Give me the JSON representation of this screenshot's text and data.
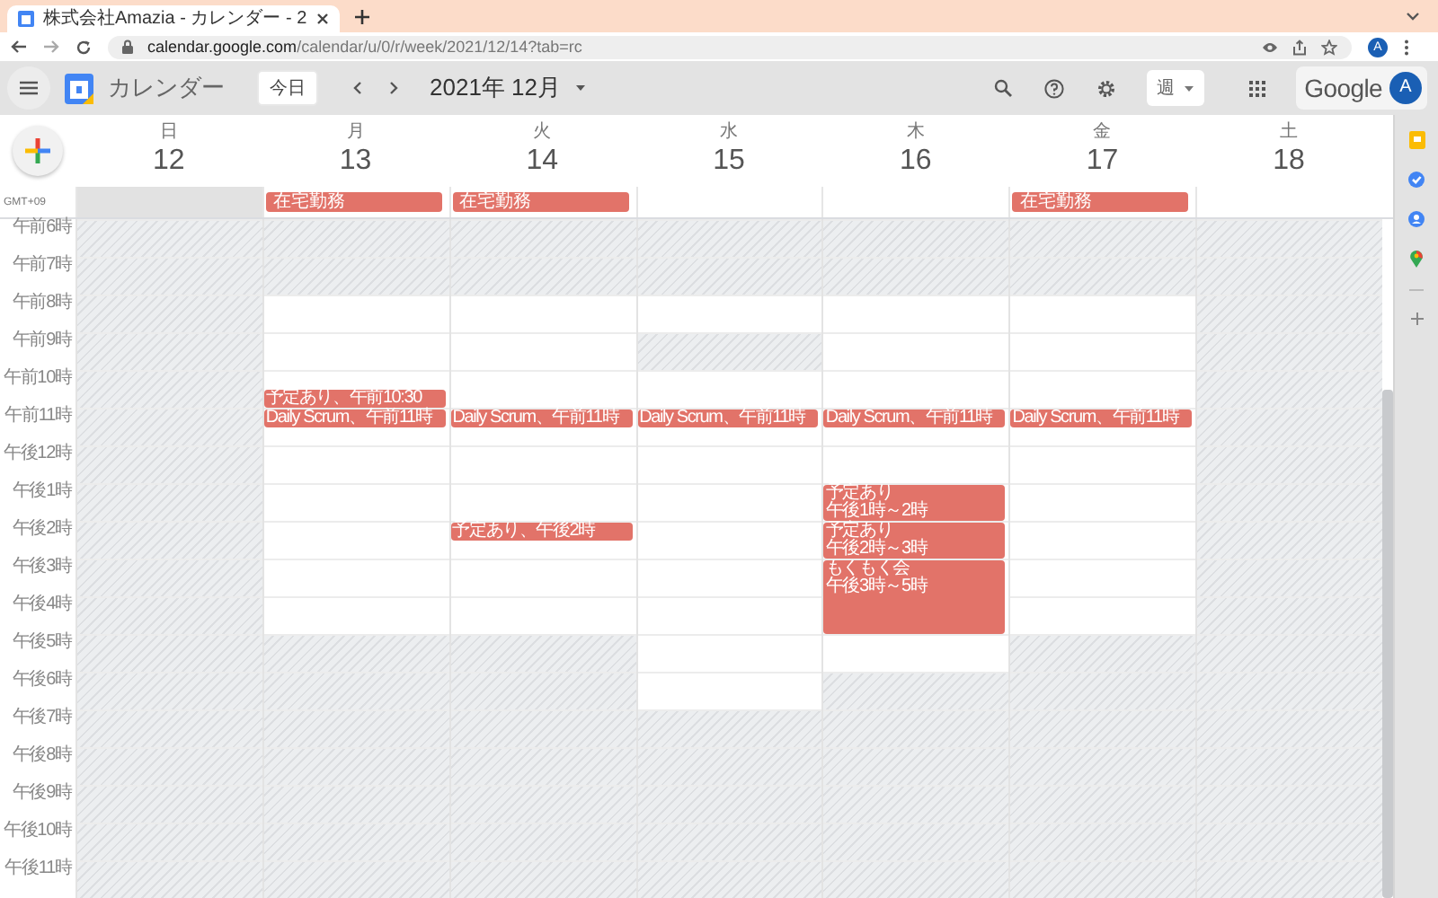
{
  "browser": {
    "tab_title": "株式会社Amazia - カレンダー - 2",
    "url": {
      "host": "calendar.google.com",
      "path": "/calendar/u/0/r/week/2021/12/14?tab=rc"
    },
    "profile_initial": "A"
  },
  "app": {
    "name": "カレンダー",
    "today_button": "今日",
    "period": "2021年 12月",
    "view": "週",
    "brand": "Google",
    "avatar_initial": "A"
  },
  "timezone": "GMT+09",
  "hours": [
    "午前6時",
    "午前7時",
    "午前8時",
    "午前9時",
    "午前10時",
    "午前11時",
    "午後12時",
    "午後1時",
    "午後2時",
    "午後3時",
    "午後4時",
    "午後5時",
    "午後6時",
    "午後7時",
    "午後8時",
    "午後9時",
    "午後10時",
    "午後11時"
  ],
  "days": [
    {
      "weekday": "日",
      "date": "12",
      "allday_shaded": true,
      "slots": [
        {
          "open": false
        },
        {
          "open": false
        },
        {
          "open": false
        },
        {
          "open": false
        },
        {
          "open": false
        },
        {
          "open": false
        },
        {
          "open": false
        },
        {
          "open": false
        },
        {
          "open": false
        },
        {
          "open": false
        },
        {
          "open": false
        },
        {
          "open": false
        },
        {
          "open": false
        },
        {
          "open": false
        },
        {
          "open": false
        },
        {
          "open": false
        },
        {
          "open": false
        },
        {
          "open": false
        }
      ]
    },
    {
      "weekday": "月",
      "date": "13",
      "allday_shaded": false,
      "allday_events": [
        "在宅勤務"
      ],
      "slots": [
        {
          "open": false
        },
        {
          "open": false
        },
        {
          "open": true
        },
        {
          "open": true
        },
        {
          "open": true,
          "events": [
            {
              "kind": "half-late",
              "title": "予定あり、午前10:30"
            }
          ]
        },
        {
          "open": true,
          "events": [
            {
              "kind": "half",
              "title": "Daily Scrum、午前11時"
            }
          ]
        },
        {
          "open": true
        },
        {
          "open": true
        },
        {
          "open": true
        },
        {
          "open": true
        },
        {
          "open": true
        },
        {
          "open": false
        },
        {
          "open": false
        },
        {
          "open": false
        },
        {
          "open": false
        },
        {
          "open": false
        },
        {
          "open": false
        },
        {
          "open": false
        }
      ]
    },
    {
      "weekday": "火",
      "date": "14",
      "allday_shaded": false,
      "allday_events": [
        "在宅勤務"
      ],
      "slots": [
        {
          "open": false
        },
        {
          "open": false
        },
        {
          "open": true
        },
        {
          "open": true
        },
        {
          "open": true
        },
        {
          "open": true,
          "events": [
            {
              "kind": "half",
              "title": "Daily Scrum、午前11時"
            }
          ]
        },
        {
          "open": true
        },
        {
          "open": true
        },
        {
          "open": true,
          "events": [
            {
              "kind": "half",
              "title": "予定あり、午後2時"
            }
          ]
        },
        {
          "open": true
        },
        {
          "open": true
        },
        {
          "open": false
        },
        {
          "open": false
        },
        {
          "open": false
        },
        {
          "open": false
        },
        {
          "open": false
        },
        {
          "open": false
        },
        {
          "open": false
        }
      ]
    },
    {
      "weekday": "水",
      "date": "15",
      "allday_shaded": false,
      "slots": [
        {
          "open": false
        },
        {
          "open": false
        },
        {
          "open": true
        },
        {
          "open": false
        },
        {
          "open": true
        },
        {
          "open": true,
          "events": [
            {
              "kind": "half",
              "title": "Daily Scrum、午前11時"
            }
          ]
        },
        {
          "open": true
        },
        {
          "open": true
        },
        {
          "open": true
        },
        {
          "open": true
        },
        {
          "open": true
        },
        {
          "open": true
        },
        {
          "open": true
        },
        {
          "open": false
        },
        {
          "open": false
        },
        {
          "open": false
        },
        {
          "open": false
        },
        {
          "open": false
        }
      ]
    },
    {
      "weekday": "木",
      "date": "16",
      "allday_shaded": false,
      "slots": [
        {
          "open": false
        },
        {
          "open": false
        },
        {
          "open": true
        },
        {
          "open": true
        },
        {
          "open": true
        },
        {
          "open": true,
          "events": [
            {
              "kind": "half",
              "title": "Daily Scrum、午前11時"
            }
          ]
        },
        {
          "open": true
        },
        {
          "open": true,
          "events": [
            {
              "kind": "hour",
              "title": "予定あり",
              "time": "午後1時～2時"
            }
          ]
        },
        {
          "open": true,
          "events": [
            {
              "kind": "hour",
              "title": "予定あり",
              "time": "午後2時～3時"
            }
          ]
        },
        {
          "open": true,
          "events": [
            {
              "kind": "two-hour",
              "title": "もくもく会",
              "time": "午後3時～5時"
            }
          ]
        },
        {
          "open": true
        },
        {
          "open": false
        },
        {
          "open": false
        },
        {
          "open": false
        },
        {
          "open": false
        },
        {
          "open": false
        },
        {
          "open": false
        }
      ]
    },
    {
      "weekday": "金",
      "date": "17",
      "allday_shaded": false,
      "allday_events": [
        "在宅勤務"
      ],
      "slots": [
        {
          "open": false
        },
        {
          "open": false
        },
        {
          "open": true
        },
        {
          "open": true
        },
        {
          "open": true
        },
        {
          "open": true,
          "events": [
            {
              "kind": "half",
              "title": "Daily Scrum、午前11時"
            }
          ]
        },
        {
          "open": true
        },
        {
          "open": true
        },
        {
          "open": true
        },
        {
          "open": true
        },
        {
          "open": true
        },
        {
          "open": false
        },
        {
          "open": false
        },
        {
          "open": false
        },
        {
          "open": false
        },
        {
          "open": false
        },
        {
          "open": false
        },
        {
          "open": false
        }
      ]
    },
    {
      "weekday": "土",
      "date": "18",
      "allday_shaded": false,
      "slots": [
        {
          "open": false
        },
        {
          "open": false
        },
        {
          "open": false
        },
        {
          "open": false
        },
        {
          "open": false
        },
        {
          "open": false
        },
        {
          "open": false
        },
        {
          "open": false
        },
        {
          "open": false
        },
        {
          "open": false
        },
        {
          "open": false
        },
        {
          "open": false
        },
        {
          "open": false
        },
        {
          "open": false
        },
        {
          "open": false
        },
        {
          "open": false
        },
        {
          "open": false
        },
        {
          "open": false
        }
      ]
    }
  ]
}
